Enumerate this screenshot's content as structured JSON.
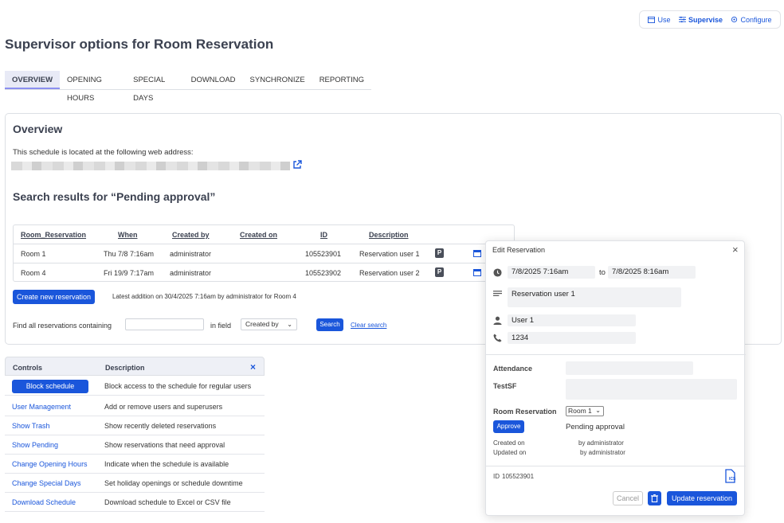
{
  "modebar": {
    "use": "Use",
    "supervise": "Supervise",
    "configure": "Configure"
  },
  "page_title": "Supervisor options for Room Reservation",
  "tabs": [
    "OVERVIEW",
    "OPENING HOURS",
    "SPECIAL DAYS",
    "DOWNLOAD",
    "SYNCHRONIZE",
    "REPORTING"
  ],
  "overview": {
    "title": "Overview",
    "subtitle": "This schedule is located at the following web address:",
    "search_title": "Search results for “Pending approval”"
  },
  "results": {
    "headers": [
      "Room_Reservation",
      "When",
      "Created by",
      "Created on",
      "ID",
      "Description"
    ],
    "rows": [
      {
        "room": "Room 1",
        "when": "Thu 7/8 7:16am",
        "created_by": "administrator",
        "created_on": "",
        "id": "105523901",
        "description": "Reservation user 1",
        "badge": "P"
      },
      {
        "room": "Room 4",
        "when": "Fri 19/9 7:17am",
        "created_by": "administrator",
        "created_on": "",
        "id": "105523902",
        "description": "Reservation user 2",
        "badge": "P"
      }
    ],
    "create_button": "Create new reservation",
    "latest": "Latest addition on 30/4/2025 7:16am by administrator for Room 4"
  },
  "find": {
    "label": "Find all reservations containing",
    "value": "",
    "in_field": "in field",
    "field_selected": "Created by",
    "search_button": "Search",
    "clear_search": "Clear search"
  },
  "controls": {
    "header_controls": "Controls",
    "header_description": "Description",
    "close": "×",
    "rows": [
      {
        "label": "Block schedule",
        "description": "Block access to the schedule for regular users",
        "is_button": true
      },
      {
        "label": "User Management",
        "description": "Add or remove users and superusers"
      },
      {
        "label": "Show Trash",
        "description": "Show recently deleted reservations"
      },
      {
        "label": "Show Pending",
        "description": "Show reservations that need approval"
      },
      {
        "label": "Change Opening Hours",
        "description": "Indicate when the schedule is available"
      },
      {
        "label": "Change Special Days",
        "description": "Set holiday openings or schedule downtime"
      },
      {
        "label": "Download Schedule",
        "description": "Download schedule to Excel or CSV file"
      }
    ]
  },
  "dialog": {
    "title": "Edit Reservation",
    "close": "×",
    "start": "7/8/2025 7:16am",
    "to": "to",
    "end": "7/8/2025 8:16am",
    "description": "Reservation user 1",
    "user": "User 1",
    "phone": "1234",
    "attendance_label": "Attendance",
    "attendance_value": "",
    "testsf_label": "TestSF",
    "testsf_value": "",
    "room_label": "Room Reservation",
    "room_value": "Room 1",
    "approve_button": "Approve",
    "status": "Pending approval",
    "created_on_label": "Created on",
    "created_by": "by administrator",
    "updated_on_label": "Updated on",
    "updated_by": "by administrator",
    "id_label": "ID",
    "id_value": "105523901",
    "ics_label": "ICS",
    "cancel_button": "Cancel",
    "update_button": "Update reservation"
  }
}
